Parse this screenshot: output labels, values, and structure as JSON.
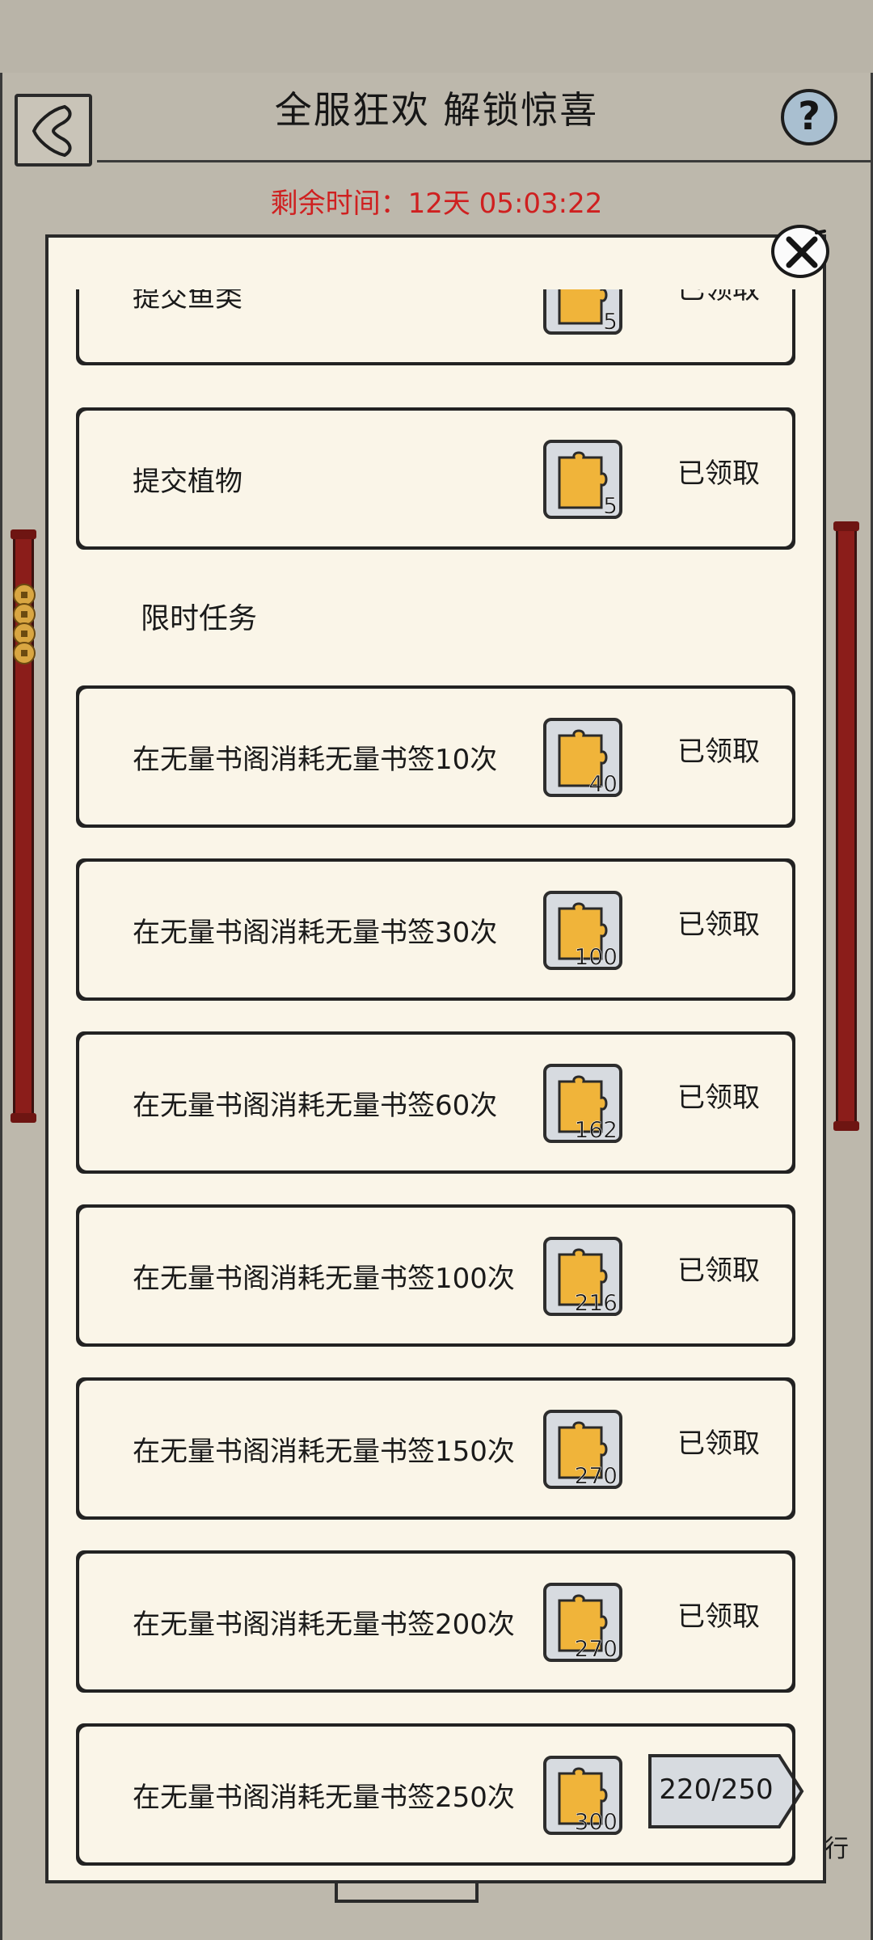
{
  "header": {
    "title": "全服狂欢 解锁惊喜",
    "timer": "剩余时间：12天 05:03:22",
    "help_symbol": "?"
  },
  "tasks": [
    {
      "name": "提交鱼类",
      "reward": "5",
      "status": "已领取"
    },
    {
      "name": "提交植物",
      "reward": "5",
      "status": "已领取"
    },
    {
      "name": "在无量书阁消耗无量书签10次",
      "reward": "40",
      "status": "已领取"
    },
    {
      "name": "在无量书阁消耗无量书签30次",
      "reward": "100",
      "status": "已领取"
    },
    {
      "name": "在无量书阁消耗无量书签60次",
      "reward": "162",
      "status": "已领取"
    },
    {
      "name": "在无量书阁消耗无量书签100次",
      "reward": "216",
      "status": "已领取"
    },
    {
      "name": "在无量书阁消耗无量书签150次",
      "reward": "270",
      "status": "已领取"
    },
    {
      "name": "在无量书阁消耗无量书签200次",
      "reward": "270",
      "status": "已领取"
    },
    {
      "name": "在无量书阁消耗无量书签250次",
      "reward": "300",
      "progress": "220/250"
    }
  ],
  "section": {
    "limited_title": "限时任务"
  },
  "background": {
    "partial_text": "行"
  },
  "colors": {
    "timer": "#cf2020",
    "panel": "#faf5e8",
    "reward_piece": "#f0b43a",
    "pillar": "#8b1d1a"
  }
}
